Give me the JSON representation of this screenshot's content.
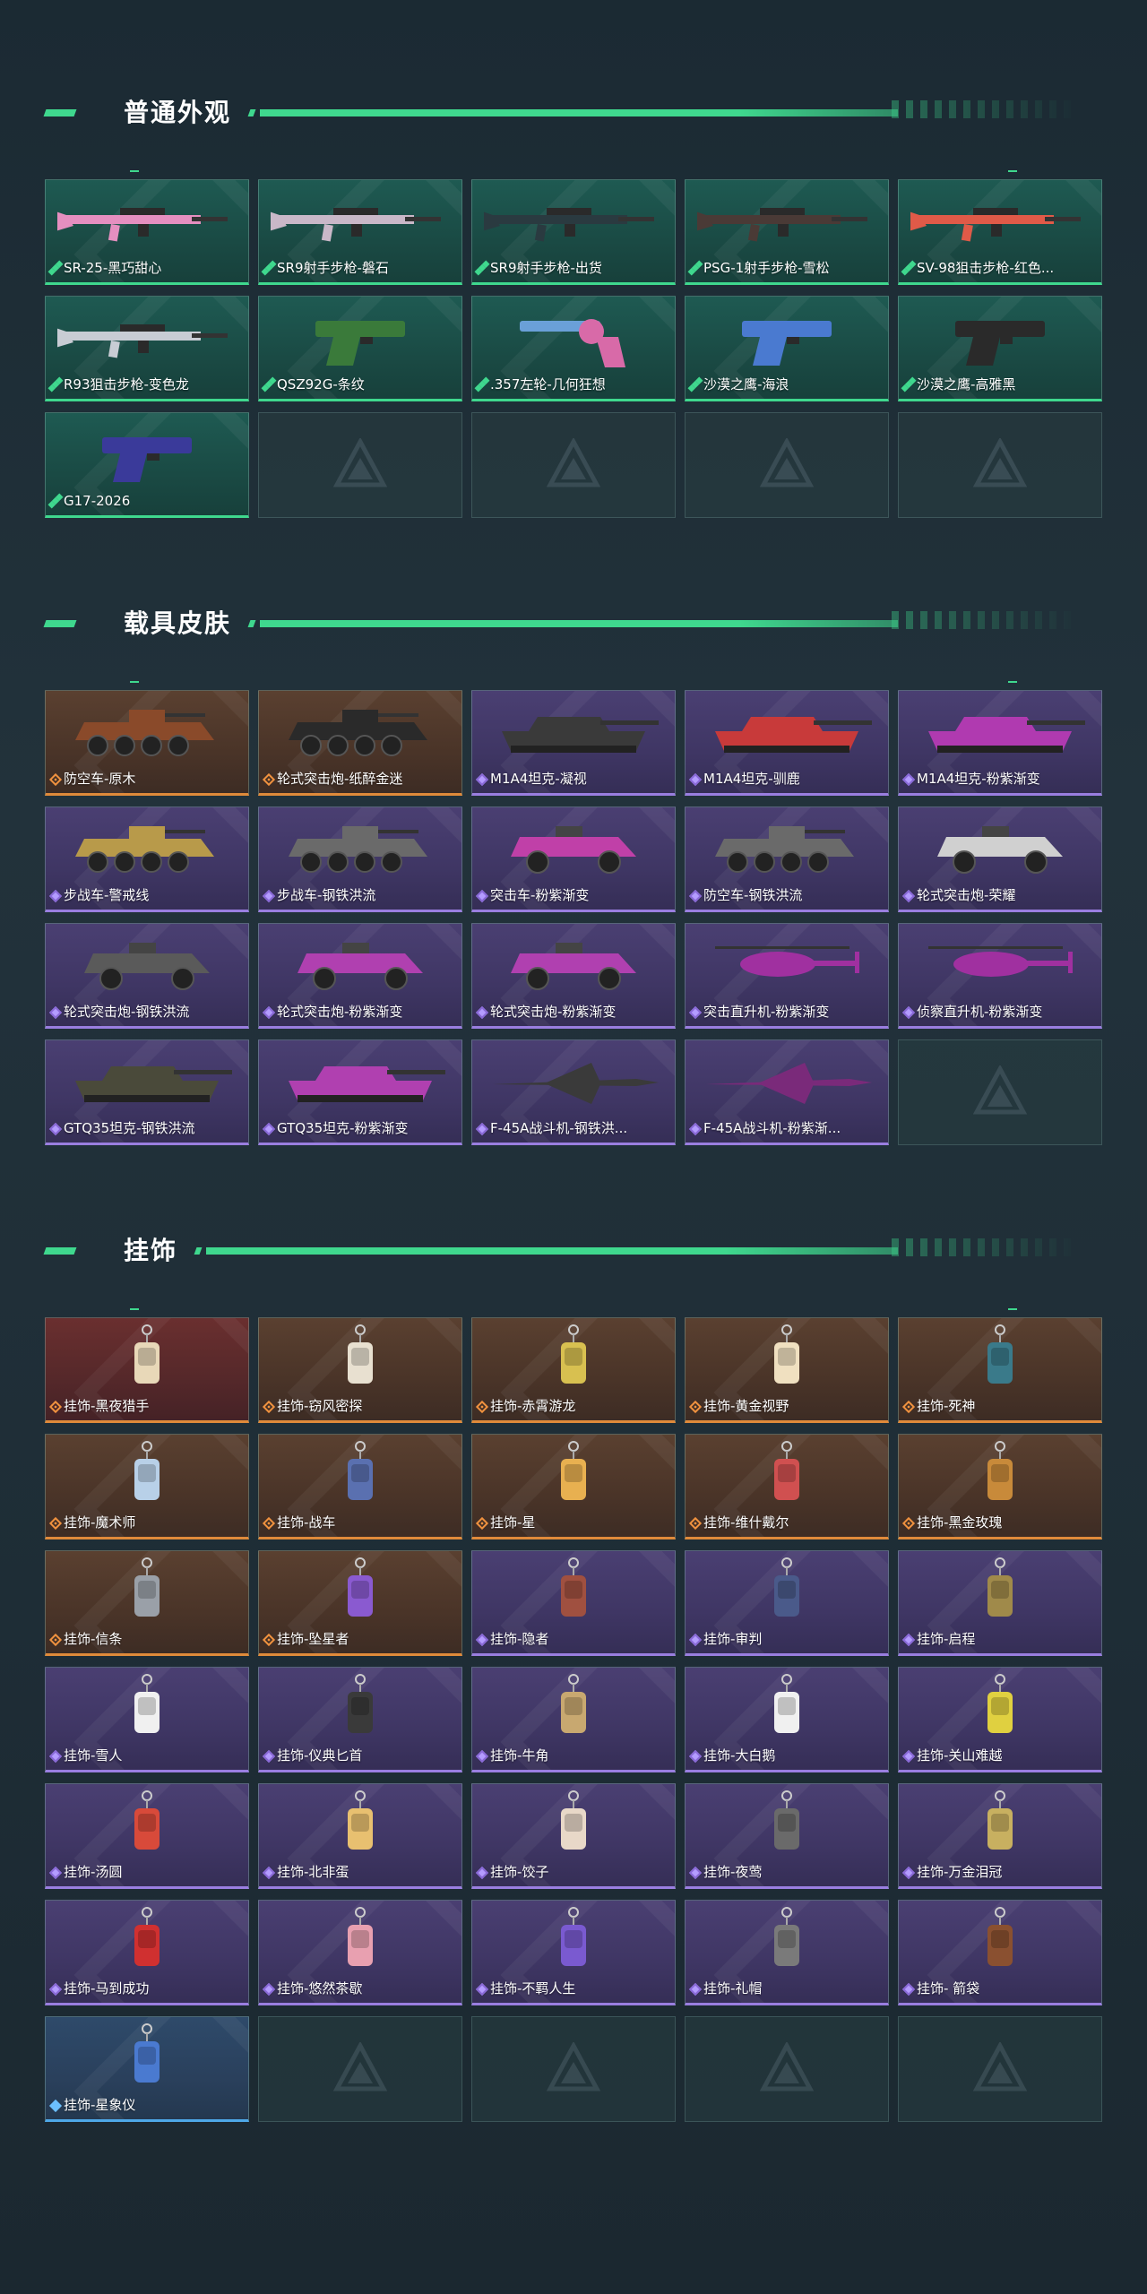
{
  "sections": {
    "weapons": {
      "title": "普通外观",
      "items": [
        {
          "label": "SR-25-黑巧甜心",
          "art": "rifle",
          "color": "#e58fc0"
        },
        {
          "label": "SR9射手步枪-磐石",
          "art": "rifle",
          "color": "#c9b8c8"
        },
        {
          "label": "SR9射手步枪-出货",
          "art": "rifle",
          "color": "#2a3a40"
        },
        {
          "label": "PSG-1射手步枪-雪松",
          "art": "rifle",
          "color": "#4a3a36"
        },
        {
          "label": "SV-98狙击步枪-红色...",
          "art": "rifle",
          "color": "#e05a48"
        },
        {
          "label": "R93狙击步枪-变色龙",
          "art": "rifle",
          "color": "#c8ccd4"
        },
        {
          "label": "QSZ92G-条纹",
          "art": "pistol",
          "color": "#3a7a3a"
        },
        {
          "label": ".357左轮-几何狂想",
          "art": "revolver",
          "color": "#d86aa8"
        },
        {
          "label": "沙漠之鹰-海浪",
          "art": "pistol",
          "color": "#4a7ad0"
        },
        {
          "label": "沙漠之鹰-高雅黑",
          "art": "pistol",
          "color": "#2a2a2a"
        },
        {
          "label": "G17-2026",
          "art": "pistol",
          "color": "#3a3a9a"
        }
      ]
    },
    "vehicles": {
      "title": "载具皮肤",
      "items": [
        {
          "label": "防空车-原木",
          "art": "apc",
          "color": "#8a4a2a",
          "rarity": "orange"
        },
        {
          "label": "轮式突击炮-纸醉金迷",
          "art": "apc",
          "color": "#2a2a2a",
          "rarity": "orange"
        },
        {
          "label": "M1A4坦克-凝视",
          "art": "tank",
          "color": "#3a3a3a",
          "rarity": "purple"
        },
        {
          "label": "M1A4坦克-驯鹿",
          "art": "tank",
          "color": "#c83a3a",
          "rarity": "purple"
        },
        {
          "label": "M1A4坦克-粉紫渐变",
          "art": "tank",
          "color": "#b03ab0",
          "rarity": "purple"
        },
        {
          "label": "步战车-警戒线",
          "art": "apc",
          "color": "#b89a4a",
          "rarity": "purple"
        },
        {
          "label": "步战车-钢铁洪流",
          "art": "apc",
          "color": "#6a6a6a",
          "rarity": "purple"
        },
        {
          "label": "突击车-粉紫渐变",
          "art": "jeep",
          "color": "#c040a8",
          "rarity": "purple"
        },
        {
          "label": "防空车-钢铁洪流",
          "art": "apc",
          "color": "#6a6a6a",
          "rarity": "purple"
        },
        {
          "label": "轮式突击炮-荣耀",
          "art": "jeep",
          "color": "#d0d0d0",
          "rarity": "purple"
        },
        {
          "label": "轮式突击炮-钢铁洪流",
          "art": "jeep",
          "color": "#5a5a5a",
          "rarity": "purple"
        },
        {
          "label": "轮式突击炮-粉紫渐变",
          "art": "jeep",
          "color": "#b040b0",
          "rarity": "purple"
        },
        {
          "label": "轮式突击炮-粉紫渐变",
          "art": "jeep",
          "color": "#b040b0",
          "rarity": "purple"
        },
        {
          "label": "突击直升机-粉紫渐变",
          "art": "heli",
          "color": "#a030a0",
          "rarity": "purple"
        },
        {
          "label": "侦察直升机-粉紫渐变",
          "art": "heli",
          "color": "#a030a0",
          "rarity": "purple"
        },
        {
          "label": "GTQ35坦克-钢铁洪流",
          "art": "tank",
          "color": "#4a4a3a",
          "rarity": "purple"
        },
        {
          "label": "GTQ35坦克-粉紫渐变",
          "art": "tank",
          "color": "#b040b0",
          "rarity": "purple"
        },
        {
          "label": "F-45A战斗机-钢铁洪...",
          "art": "jet",
          "color": "#3a3a3a",
          "rarity": "purple"
        },
        {
          "label": "F-45A战斗机-粉紫渐...",
          "art": "jet",
          "color": "#7a2a7a",
          "rarity": "purple"
        }
      ]
    },
    "pendants": {
      "title": "挂饰",
      "items": [
        {
          "label": "挂饰-黑夜猎手",
          "color": "#e8d8b8",
          "rarity": "red"
        },
        {
          "label": "挂饰-窃风密探",
          "color": "#e8e0d0",
          "rarity": "orange"
        },
        {
          "label": "挂饰-赤霄游龙",
          "color": "#d8c050",
          "rarity": "orange"
        },
        {
          "label": "挂饰-黄金视野",
          "color": "#f0e0c0",
          "rarity": "orange"
        },
        {
          "label": "挂饰-死神",
          "color": "#3a7a8a",
          "rarity": "orange"
        },
        {
          "label": "挂饰-魔术师",
          "color": "#b8d0e8",
          "rarity": "orange"
        },
        {
          "label": "挂饰-战车",
          "color": "#5a70b0",
          "rarity": "orange"
        },
        {
          "label": "挂饰-星",
          "color": "#e8b050",
          "rarity": "orange"
        },
        {
          "label": "挂饰-维什戴尔",
          "color": "#d05050",
          "rarity": "orange"
        },
        {
          "label": "挂饰-黑金玫瑰",
          "color": "#c88a3a",
          "rarity": "orange"
        },
        {
          "label": "挂饰-信条",
          "color": "#9aa0a8",
          "rarity": "orange"
        },
        {
          "label": "挂饰-坠星者",
          "color": "#8a5ad0",
          "rarity": "orange"
        },
        {
          "label": "挂饰-隐者",
          "color": "#a05040",
          "rarity": "purple"
        },
        {
          "label": "挂饰-审判",
          "color": "#4a5a8a",
          "rarity": "purple"
        },
        {
          "label": "挂饰-启程",
          "color": "#a08a4a",
          "rarity": "purple"
        },
        {
          "label": "挂饰-雪人",
          "color": "#f0f0f0",
          "rarity": "purple"
        },
        {
          "label": "挂饰-仪典匕首",
          "color": "#3a3a3a",
          "rarity": "purple"
        },
        {
          "label": "挂饰-牛角",
          "color": "#c8a870",
          "rarity": "purple"
        },
        {
          "label": "挂饰-大白鹅",
          "color": "#f0f0f0",
          "rarity": "purple"
        },
        {
          "label": "挂饰-关山难越",
          "color": "#e0d040",
          "rarity": "purple"
        },
        {
          "label": "挂饰-汤圆",
          "color": "#d84a3a",
          "rarity": "purple"
        },
        {
          "label": "挂饰-北非蛋",
          "color": "#e8c070",
          "rarity": "purple"
        },
        {
          "label": "挂饰-饺子",
          "color": "#e8d8c8",
          "rarity": "purple"
        },
        {
          "label": "挂饰-夜莺",
          "color": "#6a6a6a",
          "rarity": "purple"
        },
        {
          "label": "挂饰-万金泪冠",
          "color": "#c8b060",
          "rarity": "purple"
        },
        {
          "label": "挂饰-马到成功",
          "color": "#d03030",
          "rarity": "purple"
        },
        {
          "label": "挂饰-悠然茶歇",
          "color": "#e8a0b0",
          "rarity": "purple"
        },
        {
          "label": "挂饰-不羁人生",
          "color": "#7a5ad0",
          "rarity": "purple"
        },
        {
          "label": "挂饰-礼帽",
          "color": "#7a7a7a",
          "rarity": "purple"
        },
        {
          "label": "挂饰- 箭袋",
          "color": "#8a5030",
          "rarity": "purple"
        },
        {
          "label": "挂饰-星象仪",
          "color": "#4a7ad0",
          "rarity": "blue"
        }
      ]
    }
  },
  "colors": {
    "accent_green": "#3fd88e",
    "accent_orange": "#e08a3a",
    "accent_purple": "#9a7ee0",
    "accent_blue": "#4ea8e8"
  },
  "icons": {
    "rarity": "diamond-icon",
    "empty_slot": "logo-watermark-icon"
  }
}
